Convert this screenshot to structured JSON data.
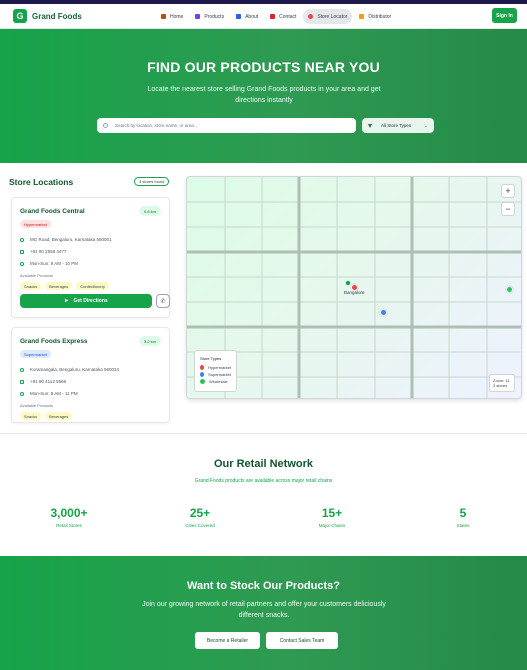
{
  "brand": {
    "name": "Grand Foods",
    "logo_letter": "G",
    "color": "#16a34a"
  },
  "nav": {
    "links": [
      {
        "label": "Home",
        "icon": "home-icon"
      },
      {
        "label": "Products",
        "icon": "box-icon"
      },
      {
        "label": "About",
        "icon": "info-icon"
      },
      {
        "label": "Contact",
        "icon": "phone-icon"
      },
      {
        "label": "Store Locator",
        "icon": "map-pin-icon",
        "active": true
      },
      {
        "label": "Distributor",
        "icon": "handshake-icon"
      }
    ],
    "signin_label": "Sign In"
  },
  "hero": {
    "title": "FIND OUR PRODUCTS NEAR YOU",
    "subtitle": "Locate the nearest store selling Grand Foods products in your area and get directions instantly",
    "search_placeholder": "Search by location, store name, or area...",
    "filter_label": "All Store Types"
  },
  "stores": {
    "title": "Store Locations",
    "found_label": "3 stores found",
    "available_label": "Available Products",
    "items": [
      {
        "name": "Grand Foods Central",
        "distance": "0.8 km",
        "type": "Hypermarket",
        "address": "MG Road, Bengaluru, Karnataka 560001",
        "phone": "+91 80 2558 4477",
        "hours": "Mon-Sun: 9 AM - 10 PM",
        "products": [
          "Snacks",
          "Beverages",
          "Confectionery"
        ],
        "directions_label": "Get Directions"
      },
      {
        "name": "Grand Foods Express",
        "distance": "3.2 km",
        "type": "Supermarket",
        "address": "Koramangala, Bengaluru, Karnataka 560034",
        "phone": "+91 80 4112 5566",
        "hours": "Mon-Sun: 8 AM - 11 PM",
        "products": [
          "Snacks",
          "Beverages"
        ]
      }
    ]
  },
  "map": {
    "place_label": "Bangalore",
    "legend_title": "Store Types",
    "legend": [
      {
        "label": "Hypermarket",
        "color": "#ef4444"
      },
      {
        "label": "Supermarket",
        "color": "#3b82f6"
      },
      {
        "label": "Wholesale",
        "color": "#22c55e"
      }
    ],
    "zoom_label": "Zoom: 11",
    "stores_count_label": "3 stores",
    "zoom_in": "+",
    "zoom_out": "−"
  },
  "network": {
    "title": "Our Retail Network",
    "subtitle": "Grand Foods products are available across major retail chains",
    "stats": [
      {
        "value": "3,000+",
        "label": "Retail Stores"
      },
      {
        "value": "25+",
        "label": "Cities Covered"
      },
      {
        "value": "15+",
        "label": "Major Chains"
      },
      {
        "value": "5",
        "label": "States"
      }
    ]
  },
  "cta": {
    "title": "Want to Stock Our Products?",
    "subtitle": "Join our growing network of retail partners and offer your customers deliciously different snacks.",
    "retailer_label": "Become a Retailer",
    "sales_label": "Contact Sales Team"
  }
}
